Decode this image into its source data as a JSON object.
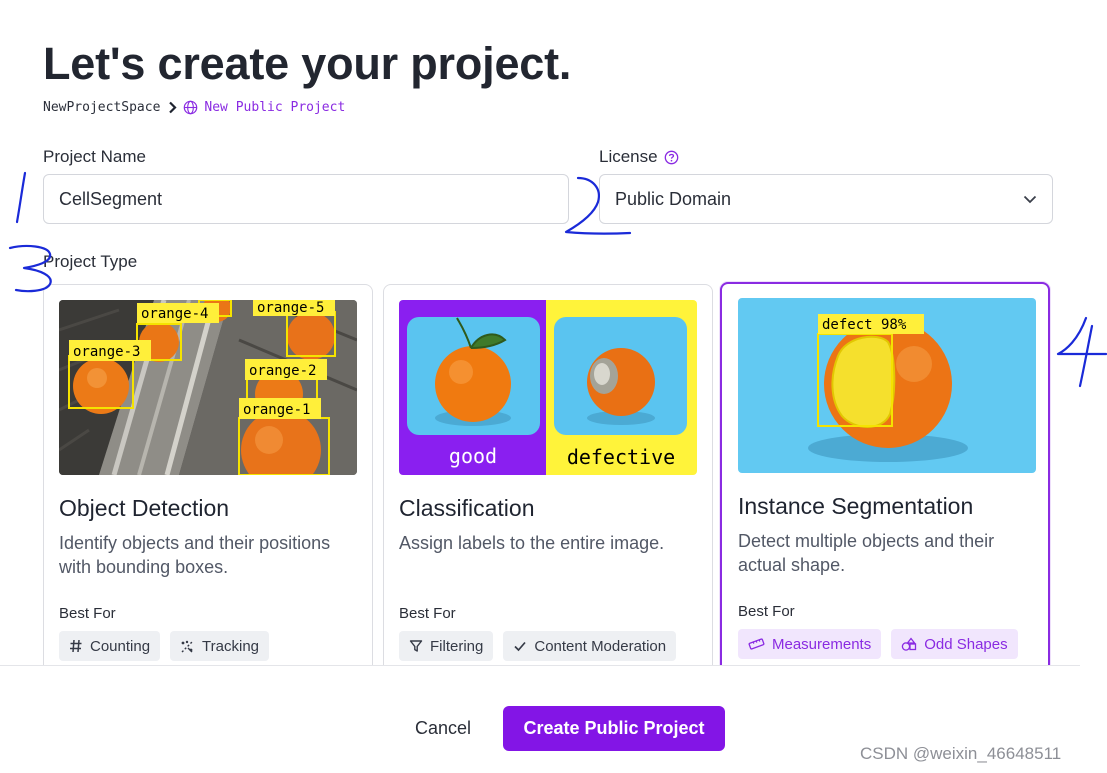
{
  "page": {
    "title": "Let's create your project.",
    "breadcrumb": {
      "workspace": "NewProjectSpace",
      "current": "New Public Project"
    }
  },
  "form": {
    "project_name_label": "Project Name",
    "project_name_value": "CellSegment",
    "license_label": "License",
    "license_value": "Public Domain",
    "project_type_label": "Project Type"
  },
  "cards": [
    {
      "title": "Object Detection",
      "description": "Identify objects and their positions with bounding boxes.",
      "best_for": "Best For",
      "tags": [
        {
          "label": "Counting",
          "icon": "hash-icon"
        },
        {
          "label": "Tracking",
          "icon": "tracking-icon"
        }
      ],
      "image_labels": [
        "orange-4",
        "orange-5",
        "orange-3",
        "orange-2",
        "orange-1"
      ]
    },
    {
      "title": "Classification",
      "description": "Assign labels to the entire image.",
      "best_for": "Best For",
      "tags": [
        {
          "label": "Filtering",
          "icon": "filter-icon"
        },
        {
          "label": "Content Moderation",
          "icon": "check-icon"
        }
      ],
      "image_labels": [
        "good",
        "defective"
      ]
    },
    {
      "title": "Instance Segmentation",
      "description": "Detect multiple objects and their actual shape.",
      "best_for": "Best For",
      "selected": true,
      "tags": [
        {
          "label": "Measurements",
          "icon": "ruler-icon"
        },
        {
          "label": "Odd Shapes",
          "icon": "shapes-icon"
        }
      ],
      "image_labels": [
        "defect 98%"
      ]
    }
  ],
  "actions": {
    "cancel": "Cancel",
    "create": "Create Public Project"
  },
  "watermark": "CSDN @weixin_46648511",
  "colors": {
    "accent": "#8315e6",
    "accent_light": "#f1e6fd",
    "annotation_yellow": "#ffef3a",
    "sky_blue": "#5ec8f2"
  }
}
